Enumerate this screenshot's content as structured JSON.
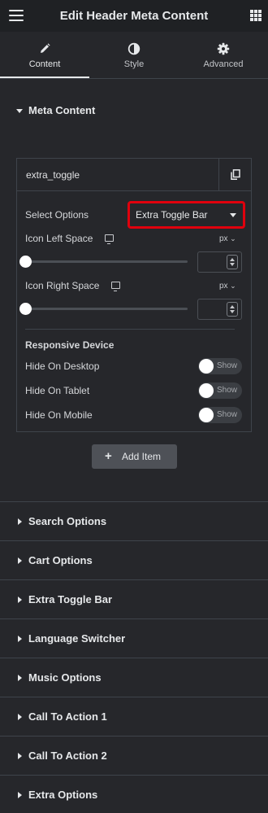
{
  "header": {
    "title": "Edit Header Meta Content",
    "menu_icon": "hamburger-icon",
    "apps_icon": "grid-icon"
  },
  "tabs": [
    {
      "label": "Content",
      "icon": "pencil-icon",
      "active": true
    },
    {
      "label": "Style",
      "icon": "half-circle-icon",
      "active": false
    },
    {
      "label": "Advanced",
      "icon": "gear-icon",
      "active": false
    }
  ],
  "meta_section": {
    "title": "Meta Content",
    "expanded": true
  },
  "item": {
    "name": "extra_toggle",
    "duplicate_icon": "copy-icon",
    "select_options_label": "Select Options",
    "select_options_value": "Extra Toggle Bar",
    "icon_left_space": {
      "label": "Icon Left Space",
      "unit": "px",
      "device_icon": "desktop-icon",
      "value": 0
    },
    "icon_right_space": {
      "label": "Icon Right Space",
      "unit": "px",
      "device_icon": "desktop-icon",
      "value": 0
    },
    "responsive_heading": "Responsive Device",
    "toggles": [
      {
        "label": "Hide On Desktop",
        "state": "Show"
      },
      {
        "label": "Hide On Tablet",
        "state": "Show"
      },
      {
        "label": "Hide On Mobile",
        "state": "Show"
      }
    ]
  },
  "add_item_label": "Add Item",
  "sections": [
    {
      "title": "Search Options"
    },
    {
      "title": "Cart Options"
    },
    {
      "title": "Extra Toggle Bar"
    },
    {
      "title": "Language Switcher"
    },
    {
      "title": "Music Options"
    },
    {
      "title": "Call To Action 1"
    },
    {
      "title": "Call To Action 2"
    },
    {
      "title": "Extra Options"
    }
  ],
  "colors": {
    "background": "#26272b",
    "topbar": "#1f2124",
    "highlight": "#e0000d",
    "divider": "#3f444b"
  }
}
